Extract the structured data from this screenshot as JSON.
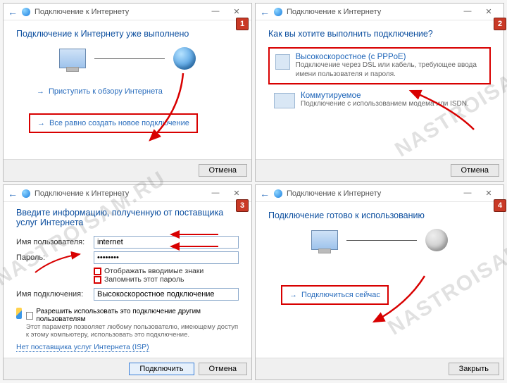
{
  "windowTitle": "Подключение к Интернету",
  "cancel": "Отмена",
  "close": "Закрыть",
  "connect": "Подключить",
  "watermark": "NASTROISAM.RU",
  "panel1": {
    "heading": "Подключение к Интернету уже выполнено",
    "browseLink": "Приступить к обзору Интернета",
    "createLink": "Все равно создать новое подключение"
  },
  "panel2": {
    "heading": "Как вы хотите выполнить подключение?",
    "opt1Title": "Высокоскоростное (с PPPoE)",
    "opt1Sub": "Подключение через DSL или кабель, требующее ввода имени пользователя и пароля.",
    "opt2Title": "Коммутируемое",
    "opt2Sub": "Подключение с использованием модема или ISDN."
  },
  "panel3": {
    "heading": "Введите информацию, полученную от поставщика услуг Интернета",
    "userLabel": "Имя пользователя:",
    "userValue": "internet",
    "passLabel": "Пароль:",
    "passValue": "••••••••",
    "showChars": "Отображать вводимые знаки",
    "remember": "Запомнить этот пароль",
    "connNameLabel": "Имя подключения:",
    "connNameValue": "Высокоскоростное подключение",
    "permTitle": "Разрешить использовать это подключение другим пользователям",
    "permSub": "Этот параметр позволяет любому пользователю, имеющему доступ к этому компьютеру, использовать это подключение.",
    "noIsp": "Нет поставщика услуг Интернета (ISP)"
  },
  "panel4": {
    "heading": "Подключение готово к использованию",
    "connectNow": "Подключиться сейчас"
  }
}
